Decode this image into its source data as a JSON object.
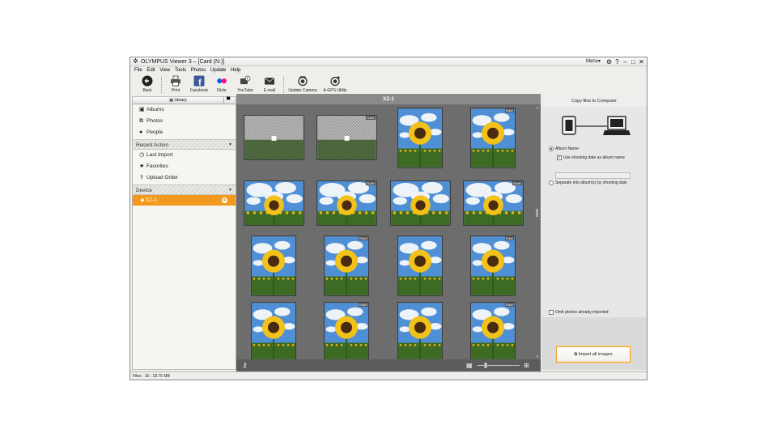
{
  "window": {
    "title": "OLYMPUS Viewer 3 – [Card (N:)]",
    "menu_button": "Menu",
    "menu_arrow": "▾",
    "controls": [
      "⚙",
      "?",
      "–",
      "□",
      "✕"
    ]
  },
  "menubar": [
    "File",
    "Edit",
    "View",
    "Tools",
    "Photos",
    "Update",
    "Help"
  ],
  "toolbar": {
    "back": "Back",
    "print": "Print",
    "facebook": "Facebook",
    "flickr": "Flickr",
    "youtube": "YouTube",
    "email": "E-mail",
    "update_camera": "Update Camera",
    "agps": "A-GPS Utility"
  },
  "sidebar": {
    "library_tab": "Library",
    "items": [
      {
        "label": "Albums",
        "icon": "album-icon"
      },
      {
        "label": "Photos",
        "icon": "photos-icon"
      },
      {
        "label": "People",
        "icon": "people-icon"
      }
    ],
    "recent_header": "Recent Action",
    "recent_items": [
      {
        "label": "Last Import",
        "icon": "clock-icon"
      },
      {
        "label": "Favorites",
        "icon": "star-icon"
      },
      {
        "label": "Upload Order",
        "icon": "upload-icon"
      }
    ],
    "device_header": "Device",
    "device_item": "XZ-1"
  },
  "center": {
    "header": "XZ-1",
    "raw_badge": "RAW",
    "thumbnails": [
      {
        "kind": "placeholder",
        "orientation": "landscape",
        "raw": false
      },
      {
        "kind": "placeholder",
        "orientation": "landscape",
        "raw": true
      },
      {
        "kind": "photo",
        "orientation": "portrait",
        "raw": false
      },
      {
        "kind": "photo",
        "orientation": "portrait",
        "raw": true
      },
      {
        "kind": "photo",
        "orientation": "landscape",
        "raw": false
      },
      {
        "kind": "photo",
        "orientation": "landscape",
        "raw": true
      },
      {
        "kind": "photo",
        "orientation": "landscape",
        "raw": false
      },
      {
        "kind": "photo",
        "orientation": "landscape",
        "raw": true
      },
      {
        "kind": "photo",
        "orientation": "portrait",
        "raw": false
      },
      {
        "kind": "photo",
        "orientation": "portrait",
        "raw": true
      },
      {
        "kind": "photo",
        "orientation": "portrait",
        "raw": false
      },
      {
        "kind": "photo",
        "orientation": "portrait",
        "raw": true
      },
      {
        "kind": "photo",
        "orientation": "portrait",
        "raw": false
      },
      {
        "kind": "photo",
        "orientation": "portrait",
        "raw": true
      },
      {
        "kind": "photo",
        "orientation": "portrait",
        "raw": false
      },
      {
        "kind": "photo",
        "orientation": "portrait",
        "raw": true
      }
    ]
  },
  "right_panel": {
    "header": "Copy files to Computer",
    "album_name": "Album Name",
    "use_date": "Use shooting date as album name",
    "separate": "Separate into album(s) by shooting date",
    "omit": "Omit photos already imported",
    "import_button": "Import all images"
  },
  "status": "Files : 16 : 18.75 MB",
  "colors": {
    "accent": "#f39a1e",
    "viewer_bg": "#6d6d6d",
    "panel_bg": "#f0eeeb"
  }
}
